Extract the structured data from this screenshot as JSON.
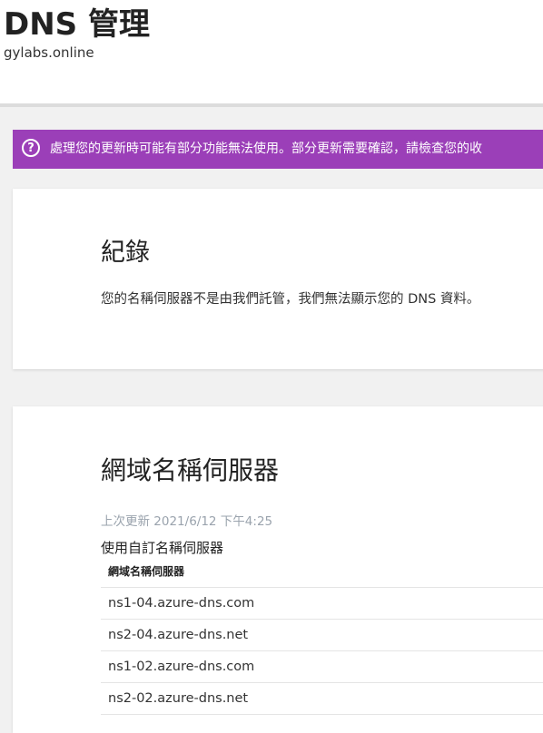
{
  "header": {
    "title": "DNS 管理",
    "subtitle": "gylabs.online"
  },
  "banner": {
    "icon": "question-circle-icon",
    "text": "處理您的更新時可能有部分功能無法使用。部分更新需要確認，請檢查您的收",
    "color": "#9b3fb8"
  },
  "records": {
    "heading": "紀錄",
    "message": "您的名稱伺服器不是由我們託管，我們無法顯示您的 DNS 資料。"
  },
  "nameservers": {
    "heading": "網域名稱伺服器",
    "last_updated": "上次更新 2021/6/12 下午4:25",
    "custom_label": "使用自訂名稱伺服器",
    "column_header": "網域名稱伺服器",
    "rows": [
      "ns1-04.azure-dns.com",
      "ns2-04.azure-dns.net",
      "ns1-02.azure-dns.com",
      "ns2-02.azure-dns.net"
    ]
  }
}
